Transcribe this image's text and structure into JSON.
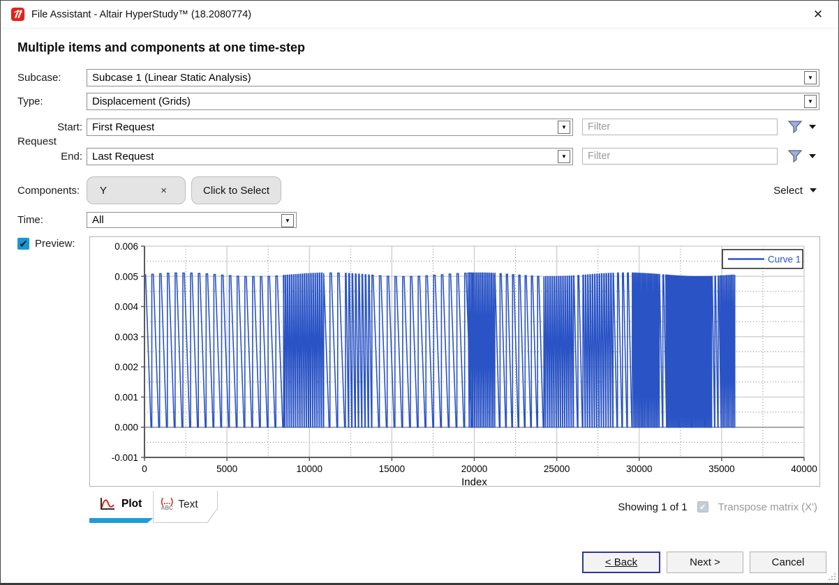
{
  "window": {
    "title": "File Assistant - Altair HyperStudy™ (18.2080774)",
    "close_glyph": "✕"
  },
  "heading": "Multiple items and components at one time-step",
  "form": {
    "subcase": {
      "label": "Subcase:",
      "value": "Subcase 1 (Linear Static Analysis)"
    },
    "type": {
      "label": "Type:",
      "value": "Displacement (Grids)"
    },
    "request": {
      "group_label": "Request",
      "start_label": "Start:",
      "start_value": "First Request",
      "end_label": "End:",
      "end_value": "Last Request",
      "filter_placeholder": "Filter"
    },
    "components": {
      "label": "Components:",
      "chip_value": "Y",
      "chip_remove": "×",
      "click_to_select": "Click to Select",
      "select_menu": "Select"
    },
    "time": {
      "label": "Time:",
      "value": "All"
    },
    "preview": {
      "label": "Preview:",
      "checked": true
    }
  },
  "tabs": [
    {
      "label": "Plot",
      "active": true
    },
    {
      "label": "Text",
      "active": false
    }
  ],
  "status": {
    "showing": "Showing 1 of 1",
    "transpose": "Transpose matrix (X')",
    "transpose_checked": true
  },
  "buttons": {
    "back": "< Back",
    "next": "Next >",
    "cancel": "Cancel"
  },
  "colors": {
    "accent_blue": "#1d9cd8",
    "curve_blue": "#2a53c5",
    "logo_red": "#e2231a",
    "checkbox_blue": "#1a96d5"
  },
  "chart_data": {
    "type": "line",
    "xlabel": "Index",
    "ylabel": "",
    "xlim": [
      0,
      40000
    ],
    "ylim": [
      -0.001,
      0.006
    ],
    "x_ticks": [
      0,
      5000,
      10000,
      15000,
      20000,
      25000,
      30000,
      35000,
      40000
    ],
    "y_ticks": [
      -0.001,
      0.0,
      0.001,
      0.002,
      0.003,
      0.004,
      0.005,
      0.006
    ],
    "grid": true,
    "legend": {
      "position": "top-right",
      "entries": [
        {
          "name": "Curve 1",
          "color": "#2a53c5"
        }
      ]
    },
    "waveform": {
      "kind": "sawtooth",
      "peak": 0.00505,
      "base": 0.0,
      "end_x": 35800,
      "segments": [
        {
          "from": 0,
          "to": 8400,
          "cycle": 470
        },
        {
          "from": 8400,
          "to": 10800,
          "cycle": 130
        },
        {
          "from": 10800,
          "to": 12200,
          "cycle": 470
        },
        {
          "from": 12200,
          "to": 13800,
          "cycle": 200
        },
        {
          "from": 13800,
          "to": 19600,
          "cycle": 470
        },
        {
          "from": 19600,
          "to": 21200,
          "cycle": 110
        },
        {
          "from": 21200,
          "to": 24200,
          "cycle": 380
        },
        {
          "from": 24200,
          "to": 26000,
          "cycle": 130
        },
        {
          "from": 26000,
          "to": 26600,
          "cycle": 300
        },
        {
          "from": 26600,
          "to": 28400,
          "cycle": 140
        },
        {
          "from": 28400,
          "to": 29600,
          "cycle": 300
        },
        {
          "from": 29600,
          "to": 31200,
          "cycle": 90
        },
        {
          "from": 31200,
          "to": 31600,
          "cycle": 250
        },
        {
          "from": 31600,
          "to": 34400,
          "cycle": 80
        },
        {
          "from": 34400,
          "to": 34900,
          "cycle": 200
        },
        {
          "from": 34900,
          "to": 35800,
          "cycle": 100
        }
      ]
    }
  }
}
